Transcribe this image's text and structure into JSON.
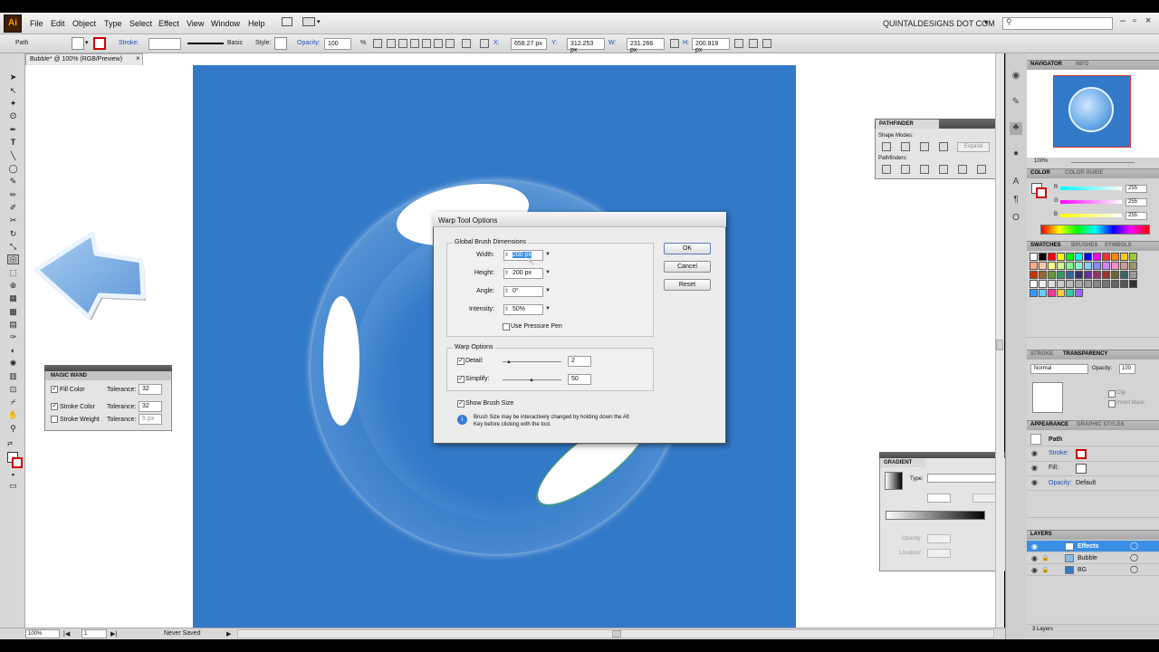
{
  "app": {
    "logo": "Ai",
    "brand": "QUINTALDESIGNS DOT COM",
    "brand_arrow": "▾"
  },
  "menu": [
    "File",
    "Edit",
    "Object",
    "Type",
    "Select",
    "Effect",
    "View",
    "Window",
    "Help"
  ],
  "control_bar": {
    "object_type": "Path",
    "stroke_label": "Stroke:",
    "brush_label": "Basic",
    "style_label": "Style:",
    "opacity_label": "Opacity:",
    "opacity_value": "100",
    "percent": "%",
    "x_label": "X:",
    "x_value": "658.27 px",
    "y_label": "Y:",
    "y_value": "312.253 px",
    "w_label": "W:",
    "w_value": "231.266 px",
    "h_label": "H:",
    "h_value": "200.819 px"
  },
  "document": {
    "tab_title": "Bubble* @ 100% (RGB/Preview)",
    "tab_close": "×"
  },
  "status_bar": {
    "zoom": "100%",
    "page": "1",
    "status": "Never Saved"
  },
  "dialog": {
    "title": "Warp Tool Options",
    "global_group": "Global Brush Dimensions",
    "width_label": "Width:",
    "width_value": "200 px",
    "height_label": "Height:",
    "height_value": "200 px",
    "angle_label": "Angle:",
    "angle_value": "0°",
    "intensity_label": "Intensity:",
    "intensity_value": "50%",
    "pressure_label": "Use Pressure Pen",
    "warp_group": "Warp Options",
    "detail_label": "Detail:",
    "detail_value": "2",
    "simplify_label": "Simplify:",
    "simplify_value": "50",
    "show_brush_label": "Show Brush Size",
    "info_text_1": "Brush Size may be interactively changed by holding down the Alt",
    "info_text_2": "Key before clicking with the tool.",
    "ok": "OK",
    "cancel": "Cancel",
    "reset": "Reset"
  },
  "magic_wand": {
    "title": "MAGIC WAND",
    "rows": [
      {
        "label": "Fill Color",
        "tol_label": "Tolerance:",
        "value": "32",
        "checked": true
      },
      {
        "label": "Stroke Color",
        "tol_label": "Tolerance:",
        "value": "32",
        "checked": true
      },
      {
        "label": "Stroke Weight",
        "tol_label": "Tolerance:",
        "value": "5 px",
        "checked": false
      }
    ]
  },
  "pathfinder": {
    "title": "PATHFINDER",
    "shape_modes": "Shape Modes:",
    "expand": "Expand",
    "pathfinders": "Pathfinders:"
  },
  "gradient": {
    "title": "GRADIENT",
    "type_label": "Type:",
    "opacity_label": "Opacity:",
    "location_label": "Location:"
  },
  "right_panels": {
    "navigator_tab": "NAVIGATOR",
    "info_tab": "INFO",
    "nav_zoom": "100%",
    "color_tab": "COLOR",
    "color_guide_tab": "COLOR GUIDE",
    "r_label": "R",
    "g_label": "G",
    "b_label": "B",
    "r_value": "255",
    "g_value": "255",
    "b_value": "255",
    "swatches_tab": "SWATCHES",
    "brushes_tab": "BRUSHES",
    "symbols_tab": "SYMBOLS",
    "stroke_tab": "STROKE",
    "transparency_tab": "TRANSPARENCY",
    "blend_mode": "Normal",
    "transp_opacity_label": "Opacity:",
    "transp_opacity": "100",
    "clip": "Clip",
    "invert_mask": "Invert Mask",
    "appearance_tab": "APPEARANCE",
    "graphic_styles_tab": "GRAPHIC STYLES",
    "appearance_path": "Path",
    "appearance_stroke": "Stroke:",
    "appearance_fill": "Fill:",
    "appearance_opacity": "Opacity:",
    "appearance_opacity_value": "Default",
    "layers_tab": "LAYERS",
    "layers": [
      "Effects",
      "Bubble",
      "BG"
    ],
    "layers_count": "3 Layers"
  },
  "colors": {
    "artboard": "#3279c8",
    "selection": "#3a8ee6"
  }
}
